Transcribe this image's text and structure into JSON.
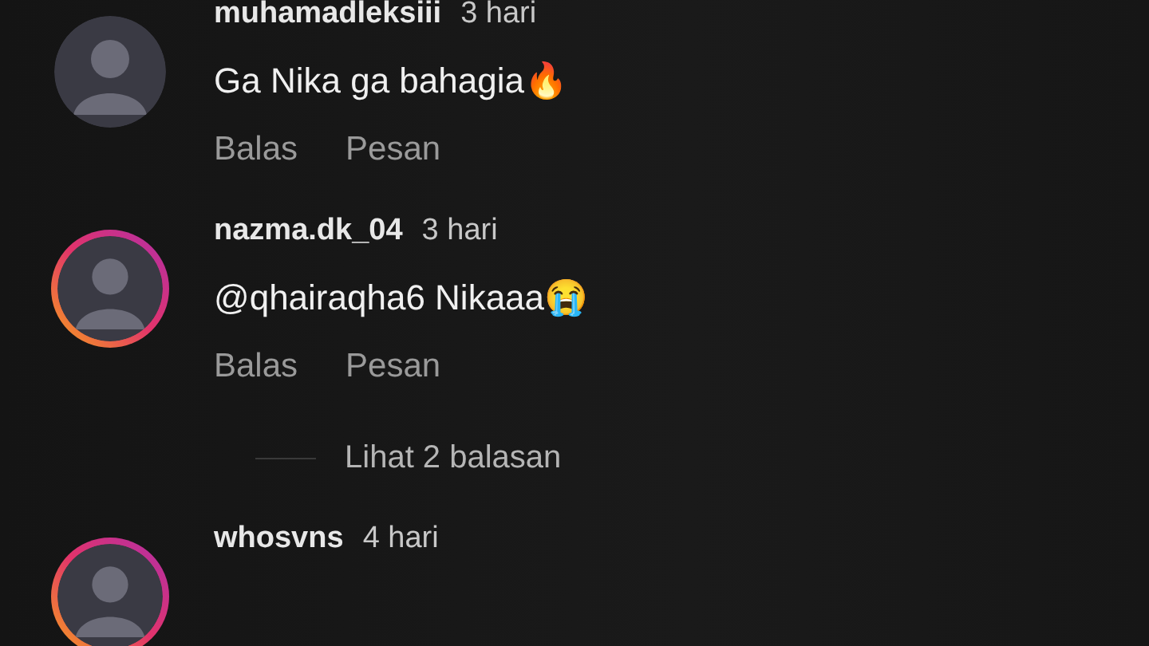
{
  "comments": [
    {
      "username": "muhamadleksiii",
      "time": "3 hari",
      "story_ring": false,
      "text": "Ga Nika ga bahagia🔥",
      "actions": [
        "Balas",
        "Pesan"
      ]
    },
    {
      "username": "nazma.dk_04",
      "time": "3 hari",
      "story_ring": true,
      "text": "@qhairaqha6 Nikaaa😭",
      "actions": [
        "Balas",
        "Pesan"
      ],
      "replies_link": "Lihat 2 balasan"
    },
    {
      "username": "whosvns",
      "time": "4 hari",
      "story_ring": true
    }
  ]
}
